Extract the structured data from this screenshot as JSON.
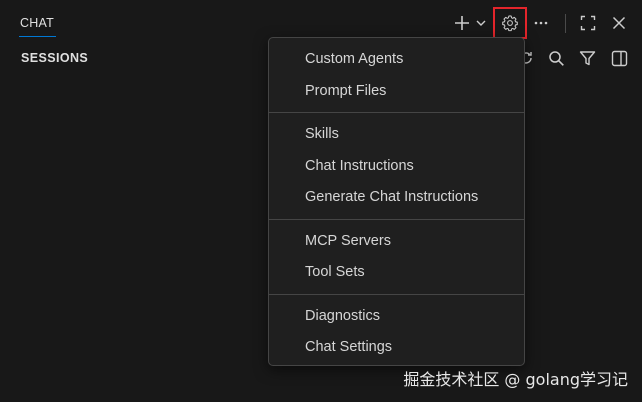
{
  "panel": {
    "tab_label": "CHAT",
    "sessions_title": "SESSIONS"
  },
  "toolbar": {
    "icons": [
      "plus-icon",
      "chevron-down-icon",
      "gear-icon",
      "more-icon",
      "maximize-icon",
      "close-icon"
    ]
  },
  "sessions_toolbar": {
    "icons": [
      "refresh-icon",
      "search-icon",
      "filter-icon",
      "split-layout-icon"
    ]
  },
  "menu": {
    "groups": [
      {
        "items": [
          "Custom Agents",
          "Prompt Files"
        ]
      },
      {
        "items": [
          "Skills",
          "Chat Instructions",
          "Generate Chat Instructions"
        ]
      },
      {
        "items": [
          "MCP Servers",
          "Tool Sets"
        ]
      },
      {
        "items": [
          "Diagnostics",
          "Chat Settings"
        ]
      }
    ]
  },
  "watermark": "掘金技术社区 @ golang学习记",
  "colors": {
    "background": "#181818",
    "menu_background": "#1f1f1f",
    "menu_border": "#454545",
    "accent": "#0078d4",
    "highlight": "#e4252b"
  }
}
